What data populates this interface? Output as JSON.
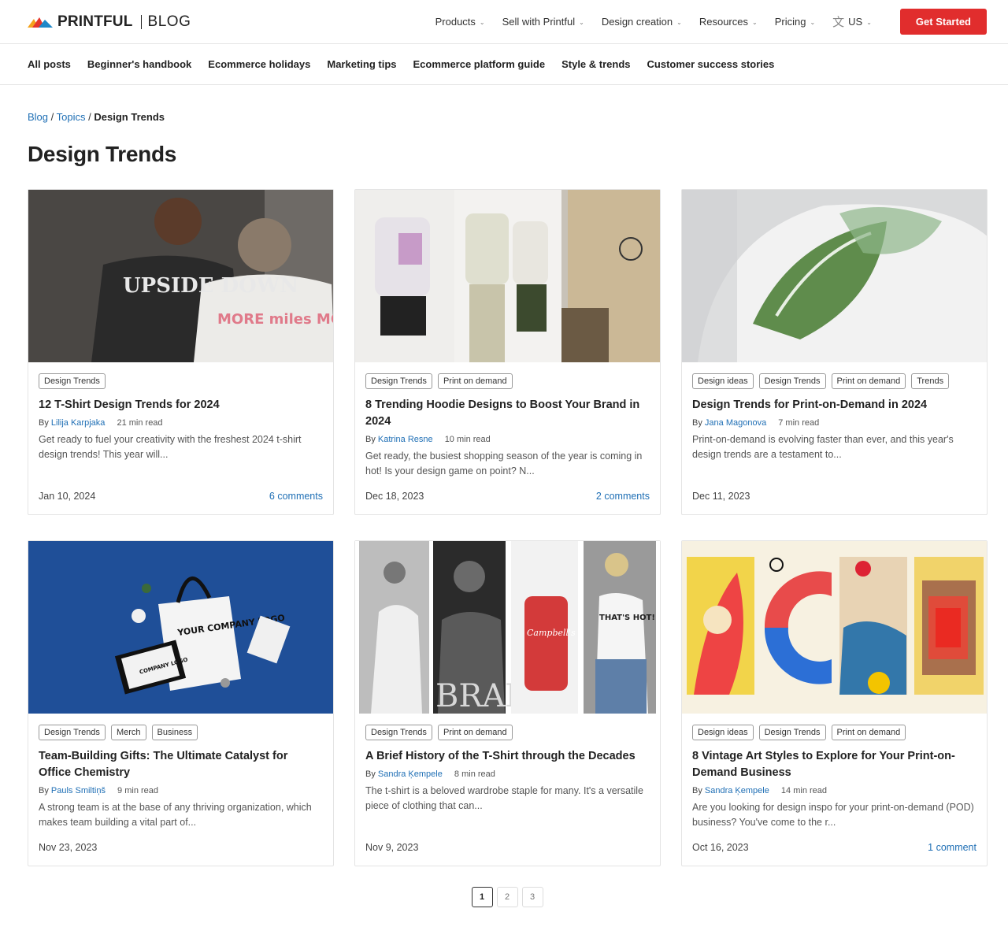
{
  "header": {
    "logo_text": "PRINTFUL",
    "logo_blog": "BLOG",
    "nav": [
      "Products",
      "Sell with Printful",
      "Design creation",
      "Resources",
      "Pricing"
    ],
    "lang": "US",
    "cta": "Get Started"
  },
  "categories": [
    "All posts",
    "Beginner's handbook",
    "Ecommerce holidays",
    "Marketing tips",
    "Ecommerce platform guide",
    "Style & trends",
    "Customer success stories"
  ],
  "breadcrumb": {
    "blog": "Blog",
    "sep1": "/",
    "topics": "Topics",
    "sep2": "/",
    "current": "Design Trends"
  },
  "page_title": "Design Trends",
  "by_label": "By",
  "posts": [
    {
      "tags": [
        "Design Trends"
      ],
      "title": "12 T-Shirt Design Trends for 2024",
      "author": "Lilija Karpjaka",
      "read": "21 min read",
      "excerpt": "Get ready to fuel your creativity with the freshest 2024 t-shirt design trends!  This year will...",
      "date": "Jan 10, 2024",
      "comments": "6 comments"
    },
    {
      "tags": [
        "Design Trends",
        "Print on demand"
      ],
      "title": "8 Trending Hoodie Designs to Boost Your Brand in 2024",
      "author": "Katrina Resne",
      "read": "10 min read",
      "excerpt": "Get ready, the busiest shopping season of the year is coming in hot! Is your design game on point? N...",
      "date": "Dec 18, 2023",
      "comments": "2 comments"
    },
    {
      "tags": [
        "Design ideas",
        "Design Trends",
        "Print on demand",
        "Trends"
      ],
      "title": "Design Trends for Print-on-Demand in 2024",
      "author": "Jana Magonova",
      "read": "7 min read",
      "excerpt": "Print-on-demand is evolving faster than ever, and this year's design trends are a testament to...",
      "date": "Dec 11, 2023",
      "comments": ""
    },
    {
      "tags": [
        "Design Trends",
        "Merch",
        "Business"
      ],
      "title": "Team-Building Gifts: The Ultimate Catalyst for Office Chemistry",
      "author": "Pauls Smiltiņš",
      "read": "9 min read",
      "excerpt": "A strong team is at the base of any thriving organization, which makes team building a vital part of...",
      "date": "Nov 23, 2023",
      "comments": ""
    },
    {
      "tags": [
        "Design Trends",
        "Print on demand"
      ],
      "title": "A Brief History of the T-Shirt through the Decades",
      "author": "Sandra Ķempele",
      "read": "8 min read",
      "excerpt": "The t-shirt is a beloved wardrobe staple for many. It's a versatile piece of clothing that can...",
      "date": "Nov 9, 2023",
      "comments": ""
    },
    {
      "tags": [
        "Design ideas",
        "Design Trends",
        "Print on demand"
      ],
      "title": "8 Vintage Art Styles to Explore for Your Print-on-Demand Business",
      "author": "Sandra Ķempele",
      "read": "14 min read",
      "excerpt": "Are you looking for design inspo for your print-on-demand (POD) business? You've come to the r...",
      "date": "Oct 16, 2023",
      "comments": "1 comment"
    }
  ],
  "image_text": {
    "p1_shirt1": "UPSIDE DOWN",
    "p1_shirt2": "MORE miles MORE",
    "p4_bag": "YOUR COMPANY LOGO",
    "p4_laptop": "COMPANY LOGO",
    "p5_bran": "BRAN",
    "p5_can": "Campbell's",
    "p5_hot": "THAT'S HOT!"
  },
  "pagination": [
    "1",
    "2",
    "3"
  ]
}
